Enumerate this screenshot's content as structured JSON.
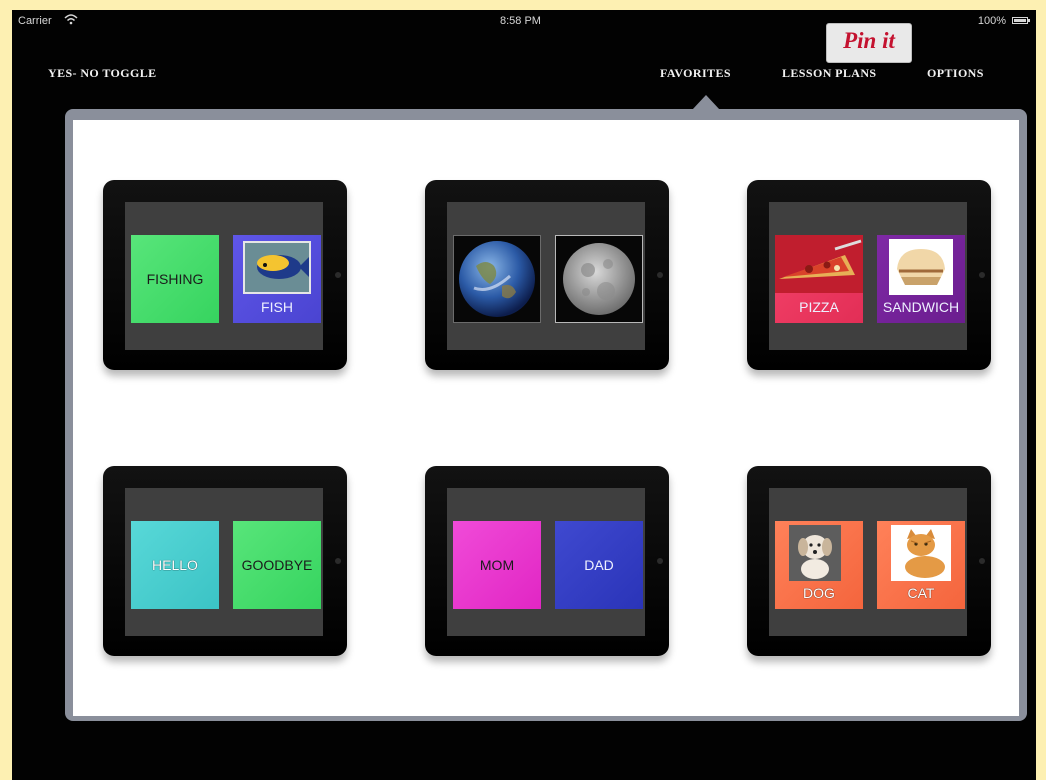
{
  "status_bar": {
    "carrier": "Carrier",
    "time": "8:58 PM",
    "battery": "100%"
  },
  "nav": {
    "yes_no_toggle": "YES- NO TOGGLE",
    "favorites": "FAVORITES",
    "lesson_plans": "LESSON PLANS",
    "options": "OPTIONS"
  },
  "pinit": "Pin it",
  "favorites": {
    "cards": [
      {
        "left_label": "FISHING",
        "right_label": "FISH"
      },
      {
        "left_label": "",
        "right_label": ""
      },
      {
        "left_label": "PIZZA",
        "right_label": "SANDWICH"
      },
      {
        "left_label": "HELLO",
        "right_label": "GOODBYE"
      },
      {
        "left_label": "MOM",
        "right_label": "DAD"
      },
      {
        "left_label": "DOG",
        "right_label": "CAT"
      }
    ]
  },
  "colors": {
    "green": "#45df6c",
    "purple": "#5650df",
    "teal": "#4dcfd0",
    "magenta": "#e934ce",
    "blue": "#3440c3",
    "red": "#ef3a61",
    "violet": "#762499",
    "orange": "#fa744b"
  },
  "icons": {
    "wifi": "wifi-icon",
    "battery": "battery-icon",
    "earth": "earth-image",
    "moon": "moon-image",
    "fish": "fish-image",
    "pizza": "pizza-image",
    "sandwich": "sandwich-image",
    "dog": "dog-image",
    "cat": "cat-image"
  }
}
